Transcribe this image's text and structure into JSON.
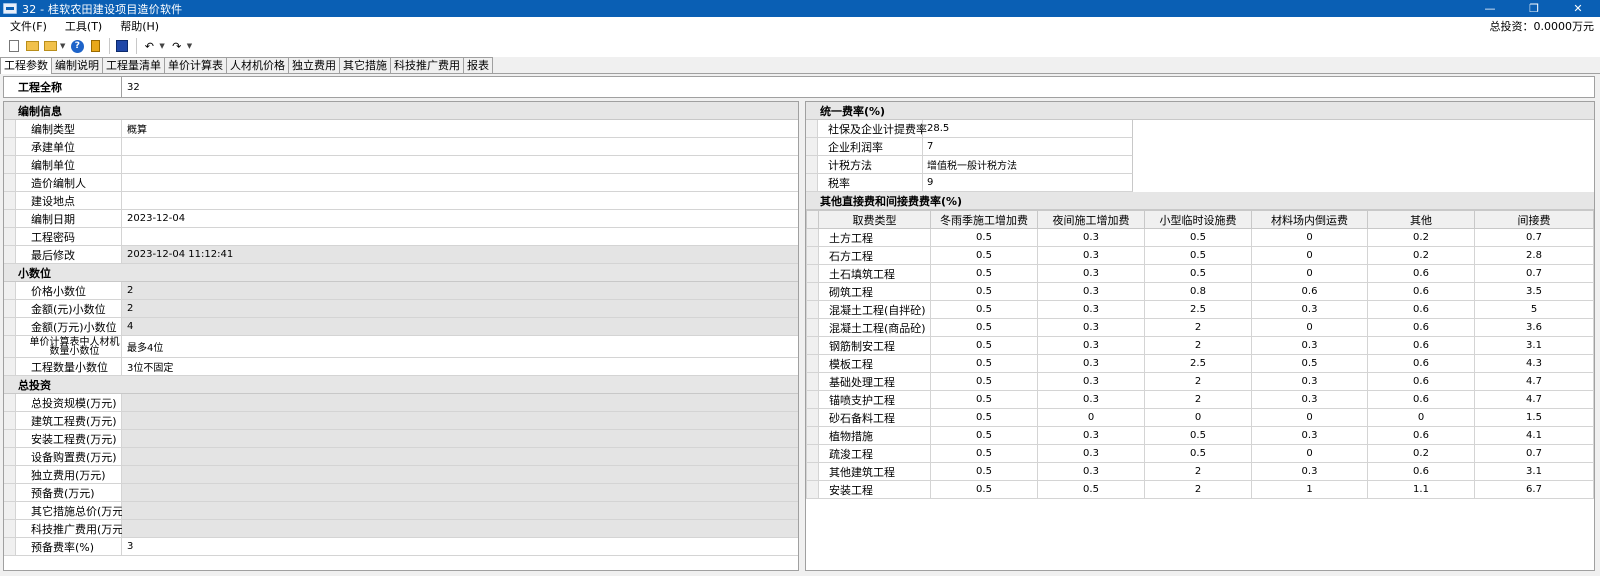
{
  "window": {
    "title": "32 - 桂软农田建设项目造价软件",
    "min": "—",
    "restore": "❐",
    "close": "✕"
  },
  "menu": {
    "items": [
      "文件(F)",
      "工具(T)",
      "帮助(H)"
    ],
    "total_label": "总投资：0.0000万元"
  },
  "tabs": [
    "工程参数",
    "编制说明",
    "工程量清单",
    "单价计算表",
    "人材机价格",
    "独立费用",
    "其它措施",
    "科技推广费用",
    "报表"
  ],
  "project": {
    "label": "工程全称",
    "value": "32"
  },
  "left": {
    "sections": {
      "compile_info": "编制信息",
      "decimals": "小数位",
      "total_invest": "总投资"
    },
    "compile_rows": [
      {
        "k": "编制类型",
        "v": "概算"
      },
      {
        "k": "承建单位",
        "v": ""
      },
      {
        "k": "编制单位",
        "v": ""
      },
      {
        "k": "造价编制人",
        "v": ""
      },
      {
        "k": "建设地点",
        "v": ""
      },
      {
        "k": "编制日期",
        "v": "2023-12-04"
      },
      {
        "k": "工程密码",
        "v": ""
      },
      {
        "k": "最后修改",
        "v": "2023-12-04 11:12:41"
      }
    ],
    "decimal_rows": [
      {
        "k": "价格小数位",
        "v": "2"
      },
      {
        "k": "金额(元)小数位",
        "v": "2"
      },
      {
        "k": "金额(万元)小数位",
        "v": "4"
      },
      {
        "k": "单价计算表中人材机数量小数位",
        "v": "最多4位"
      },
      {
        "k": "工程数量小数位",
        "v": "3位不固定"
      }
    ],
    "invest_rows": [
      {
        "k": "总投资规模(万元)",
        "v": ""
      },
      {
        "k": "建筑工程费(万元)",
        "v": ""
      },
      {
        "k": "安装工程费(万元)",
        "v": ""
      },
      {
        "k": "设备购置费(万元)",
        "v": ""
      },
      {
        "k": "独立费用(万元)",
        "v": ""
      },
      {
        "k": "预备费(万元)",
        "v": ""
      },
      {
        "k": "其它措施总价(万元)",
        "v": ""
      },
      {
        "k": "科技推广费用(万元)",
        "v": ""
      },
      {
        "k": "预备费率(%)",
        "v": "3"
      }
    ]
  },
  "right": {
    "unified_title": "统一费率(%)",
    "unified_rows": [
      {
        "k": "社保及企业计提费率",
        "v": "28.5"
      },
      {
        "k": "企业利润率",
        "v": "7"
      },
      {
        "k": "计税方法",
        "v": "增值税一般计税方法"
      },
      {
        "k": "税率",
        "v": "9"
      }
    ],
    "other_title": "其他直接费和间接费费率(%)",
    "columns": [
      "取费类型",
      "冬雨季施工增加费",
      "夜间施工增加费",
      "小型临时设施费",
      "材料场内倒运费",
      "其他",
      "间接费"
    ],
    "rows": [
      [
        "土方工程",
        "0.5",
        "0.3",
        "0.5",
        "0",
        "0.2",
        "0.7"
      ],
      [
        "石方工程",
        "0.5",
        "0.3",
        "0.5",
        "0",
        "0.2",
        "2.8"
      ],
      [
        "土石填筑工程",
        "0.5",
        "0.3",
        "0.5",
        "0",
        "0.6",
        "0.7"
      ],
      [
        "砌筑工程",
        "0.5",
        "0.3",
        "0.8",
        "0.6",
        "0.6",
        "3.5"
      ],
      [
        "混凝土工程(自拌砼)",
        "0.5",
        "0.3",
        "2.5",
        "0.3",
        "0.6",
        "5"
      ],
      [
        "混凝土工程(商品砼)",
        "0.5",
        "0.3",
        "2",
        "0",
        "0.6",
        "3.6"
      ],
      [
        "钢筋制安工程",
        "0.5",
        "0.3",
        "2",
        "0.3",
        "0.6",
        "3.1"
      ],
      [
        "模板工程",
        "0.5",
        "0.3",
        "2.5",
        "0.5",
        "0.6",
        "4.3"
      ],
      [
        "基础处理工程",
        "0.5",
        "0.3",
        "2",
        "0.3",
        "0.6",
        "4.7"
      ],
      [
        "锚喷支护工程",
        "0.5",
        "0.3",
        "2",
        "0.3",
        "0.6",
        "4.7"
      ],
      [
        "砂石备料工程",
        "0.5",
        "0",
        "0",
        "0",
        "0",
        "1.5"
      ],
      [
        "植物措施",
        "0.5",
        "0.3",
        "0.5",
        "0.3",
        "0.6",
        "4.1"
      ],
      [
        "疏浚工程",
        "0.5",
        "0.3",
        "0.5",
        "0",
        "0.2",
        "0.7"
      ],
      [
        "其他建筑工程",
        "0.5",
        "0.3",
        "2",
        "0.3",
        "0.6",
        "3.1"
      ],
      [
        "安装工程",
        "0.5",
        "0.5",
        "2",
        "1",
        "1.1",
        "6.7"
      ]
    ]
  }
}
